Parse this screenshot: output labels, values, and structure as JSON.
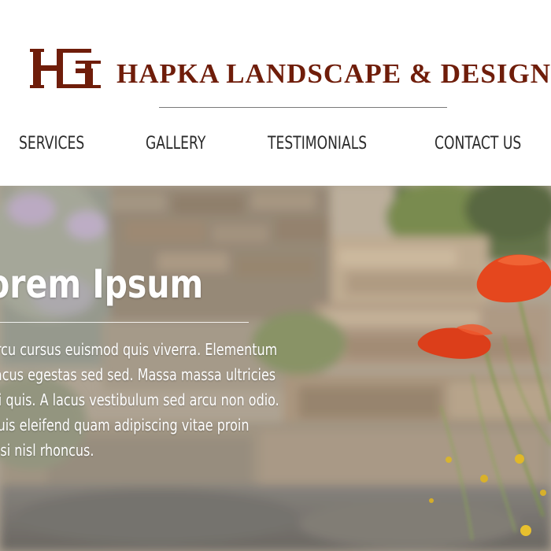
{
  "brand": {
    "logo_icon": "hg-monogram-logo",
    "name": "HAPKA LANDSCAPE & DESIGN",
    "color": "#6f1d0a"
  },
  "nav": {
    "items": [
      {
        "label": "SERVICES"
      },
      {
        "label": "GALLERY"
      },
      {
        "label": "TESTIMONIALS"
      },
      {
        "label": "CONTACT US"
      }
    ]
  },
  "hero": {
    "title": "Lorem Ipsum",
    "lines": [
      "Arcu cursus euismod quis viverra. Elementum",
      "Lacus egestas sed sed. Massa massa ultricies",
      "Mi quis. A lacus vestibulum sed arcu non odio.",
      "Quis eleifend quam adipiscing vitae proin",
      "Nisi nisl rhoncus."
    ],
    "background": "stone-steps-with-poppies-photo"
  }
}
